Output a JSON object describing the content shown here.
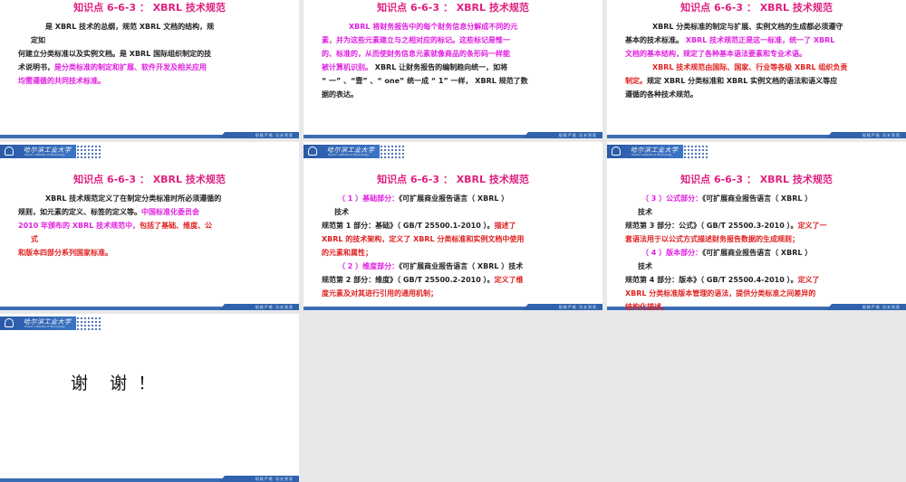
{
  "logo": {
    "name_cn": "哈尔滨工业大学",
    "name_en": "Harbin Institute of Technology"
  },
  "footer_motto": "规格严格  功夫到家",
  "colors": {
    "title": "#e0207f",
    "magenta": "#e01fe0",
    "red": "#e02020",
    "brand_blue": "#2a5aa8"
  },
  "slides": [
    {
      "title": "知识点 6-6-3 ： XBRL 技术规范",
      "lines": [
        {
          "kind": "ps",
          "segs": [
            {
              "t": "是 XBRL 技术的总纲，规范 XBRL 文档的结构，规",
              "c": "black"
            }
          ]
        },
        {
          "kind": "cont",
          "segs": [
            {
              "t": "定如",
              "c": "black"
            }
          ]
        },
        {
          "kind": "",
          "segs": [
            {
              "t": "何建立分类标准以及实例文档。是 XBRL 国际组织制定的技",
              "c": "black"
            }
          ]
        },
        {
          "kind": "",
          "segs": [
            {
              "t": "术说明书，",
              "c": "black"
            },
            {
              "t": "是分类标准的制定和扩展、软件开发及相关应用",
              "c": "magenta"
            }
          ]
        },
        {
          "kind": "",
          "segs": [
            {
              "t": "均需遵循的共同技术标准。",
              "c": "magenta"
            }
          ]
        }
      ]
    },
    {
      "title": "知识点 6-6-3 ： XBRL 技术规范",
      "lines": [
        {
          "kind": "ps",
          "segs": [
            {
              "t": "XBRL 将财务报告中的每个财务信息分解成不同的元",
              "c": "magenta"
            }
          ]
        },
        {
          "kind": "",
          "segs": [
            {
              "t": "素，并为这些元素建立与之相对应的标记。这些标记是惟一",
              "c": "magenta"
            }
          ]
        },
        {
          "kind": "",
          "segs": [
            {
              "t": "的、标准的，从而使财务信息元素就像商品的条形码一样能",
              "c": "magenta"
            }
          ]
        },
        {
          "kind": "",
          "segs": [
            {
              "t": "被计算机识别。",
              "c": "magenta"
            },
            {
              "t": " XBRL 让财务报告的编制趋向统一，如将",
              "c": "black"
            }
          ]
        },
        {
          "kind": "",
          "segs": [
            {
              "t": "“ 一” 、“壹” 、“ one” 统一成 “ 1” 一样， XBRL 规范了数",
              "c": "black"
            }
          ]
        },
        {
          "kind": "",
          "segs": [
            {
              "t": "据的表达。",
              "c": "black"
            }
          ]
        }
      ]
    },
    {
      "title": "知识点 6-6-3 ： XBRL 技术规范",
      "lines": [
        {
          "kind": "ps",
          "segs": [
            {
              "t": "XBRL 分类标准的制定与扩展、实例文档的生成都必须遵守",
              "c": "black"
            }
          ]
        },
        {
          "kind": "",
          "segs": [
            {
              "t": "基本的技术标准。",
              "c": "black"
            },
            {
              "t": " XBRL 技术规范正是这一标准，统一了 XBRL",
              "c": "magenta"
            }
          ]
        },
        {
          "kind": "",
          "segs": [
            {
              "t": "文档的基本结构，规定了各种基本语法要素和专业术语。",
              "c": "magenta"
            }
          ]
        },
        {
          "kind": "ps",
          "segs": [
            {
              "t": "XBRL 技术规范由国际、国家、行业等各级 XBRL 组织负责",
              "c": "red"
            }
          ]
        },
        {
          "kind": "",
          "segs": [
            {
              "t": "制定。",
              "c": "red"
            },
            {
              "t": "规定 XBRL 分类标准和 XBRL 实例文档的语法和语义等应",
              "c": "black"
            }
          ]
        },
        {
          "kind": "",
          "segs": [
            {
              "t": "遵循的各种技术规范。",
              "c": "black"
            }
          ]
        }
      ]
    },
    {
      "title": "知识点 6-6-3 ： XBRL 技术规范",
      "lines": [
        {
          "kind": "ps",
          "segs": [
            {
              "t": "XBRL 技术规范定义了在制定分类标准时所必须遵循的",
              "c": "black"
            }
          ]
        },
        {
          "kind": "",
          "segs": [
            {
              "t": "规则，如元素的定义、标签的定义等。",
              "c": "black"
            },
            {
              "t": "中国标准化委员会",
              "c": "magenta"
            }
          ]
        },
        {
          "kind": "",
          "segs": [
            {
              "t": "2010 年颁布的 XBRL 技术规范中，",
              "c": "magenta"
            },
            {
              "t": "包括了基础、维度、公",
              "c": "red"
            }
          ]
        },
        {
          "kind": "cont",
          "segs": [
            {
              "t": "式",
              "c": "red"
            }
          ]
        },
        {
          "kind": "",
          "segs": [
            {
              "t": "和版本四部分系列国家标准。",
              "c": "red"
            }
          ]
        }
      ]
    },
    {
      "title": "知识点 6-6-3 ： XBRL 技术规范",
      "lines": [
        {
          "kind": "sub",
          "segs": [
            {
              "t": "（ 1 ）基础部分：",
              "c": "magenta"
            },
            {
              "t": "《可扩展商业报告语言（ XBRL ）",
              "c": "black"
            }
          ]
        },
        {
          "kind": "cont",
          "segs": [
            {
              "t": "技术",
              "c": "black"
            }
          ]
        },
        {
          "kind": "",
          "segs": [
            {
              "t": "规范第 1 部分：基础》（ GB/T 25500.1-2010 ）。",
              "c": "black"
            },
            {
              "t": "描述了",
              "c": "red"
            }
          ]
        },
        {
          "kind": "",
          "segs": [
            {
              "t": "XBRL 的技术架构，定义了 XBRL 分类标准和实例文档中使用",
              "c": "red"
            }
          ]
        },
        {
          "kind": "",
          "segs": [
            {
              "t": "的元素和属性；",
              "c": "red"
            }
          ]
        },
        {
          "kind": "sub",
          "segs": [
            {
              "t": "（ 2 ）维度部分：",
              "c": "magenta"
            },
            {
              "t": "《可扩展商业报告语言（ XBRL ）技术",
              "c": "black"
            }
          ]
        },
        {
          "kind": "",
          "segs": [
            {
              "t": "规范第 2 部分：维度》（ GB/T 25500.2-2010 ）。",
              "c": "black"
            },
            {
              "t": "定义了维",
              "c": "red"
            }
          ]
        },
        {
          "kind": "",
          "segs": [
            {
              "t": "度元素及对其进行引用的通用机制；",
              "c": "red"
            }
          ]
        }
      ]
    },
    {
      "title": "知识点 6-6-3 ： XBRL 技术规范",
      "lines": [
        {
          "kind": "sub",
          "segs": [
            {
              "t": "（ 3 ）公式部分：",
              "c": "magenta"
            },
            {
              "t": "《可扩展商业报告语言（ XBRL ）",
              "c": "black"
            }
          ]
        },
        {
          "kind": "cont",
          "segs": [
            {
              "t": "技术",
              "c": "black"
            }
          ]
        },
        {
          "kind": "",
          "segs": [
            {
              "t": "规范第 3 部分：公式》（ GB/T 25500.3-2010 ）。",
              "c": "black"
            },
            {
              "t": "定义了一",
              "c": "red"
            }
          ]
        },
        {
          "kind": "",
          "segs": [
            {
              "t": "套语法用于以公式方式描述财务报告数据的生成规则；",
              "c": "red"
            }
          ]
        },
        {
          "kind": "sub",
          "segs": [
            {
              "t": "（ 4 ）版本部分：",
              "c": "magenta"
            },
            {
              "t": "《可扩展商业报告语言（ XBRL ）",
              "c": "black"
            }
          ]
        },
        {
          "kind": "cont",
          "segs": [
            {
              "t": "技术",
              "c": "black"
            }
          ]
        },
        {
          "kind": "",
          "segs": [
            {
              "t": "规范第 4 部分：版本》（ GB/T 25500.4-2010 ）。",
              "c": "black"
            },
            {
              "t": "定义了",
              "c": "red"
            }
          ]
        },
        {
          "kind": "",
          "segs": [
            {
              "t": "XBRL 分类标准版本管理的语法，提供分类标准之间差异的",
              "c": "red"
            }
          ]
        },
        {
          "kind": "",
          "segs": [
            {
              "t": "结构化描述。",
              "c": "red"
            }
          ]
        }
      ]
    }
  ],
  "final_slide": {
    "text": "谢    谢  ！"
  }
}
